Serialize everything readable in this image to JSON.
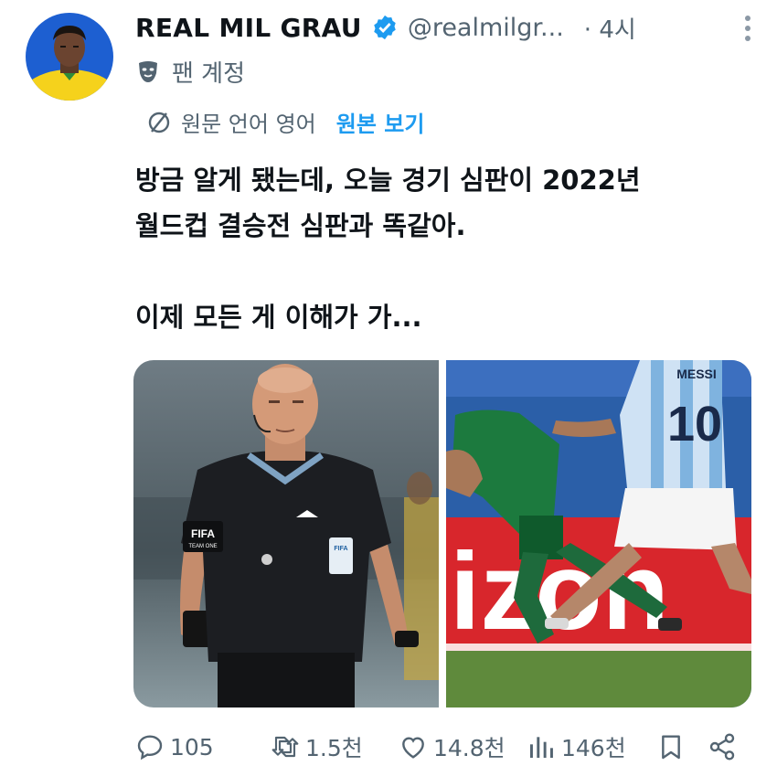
{
  "tweet": {
    "author_name": "REAL MIL GRAU",
    "handle": "@realmilgr...",
    "separator": "·",
    "time": "4시",
    "badge_label": "팬 계정",
    "translation": {
      "note": "원문 언어 영어",
      "show_original": "원본 보기"
    },
    "text_lines": [
      "방금 알게 됐는데, 오늘 경기 심판이 2022년",
      "월드컵 결승전 심판과 똑같아.",
      "",
      "이제 모든 게 이해가 가..."
    ],
    "image_left": {
      "armband_text": "FIFA",
      "armband_subtext": "TEAM ONE",
      "badge_text": "FIFA"
    },
    "image_right": {
      "shirt_name": "MESSI",
      "shirt_number": "10",
      "board_text": "izon"
    },
    "actions": {
      "replies": "105",
      "reposts": "1.5천",
      "likes": "14.8천",
      "views": "146천"
    }
  },
  "colors": {
    "text": "#0f1419",
    "secondary": "#536471",
    "accent": "#1d9bf0"
  }
}
